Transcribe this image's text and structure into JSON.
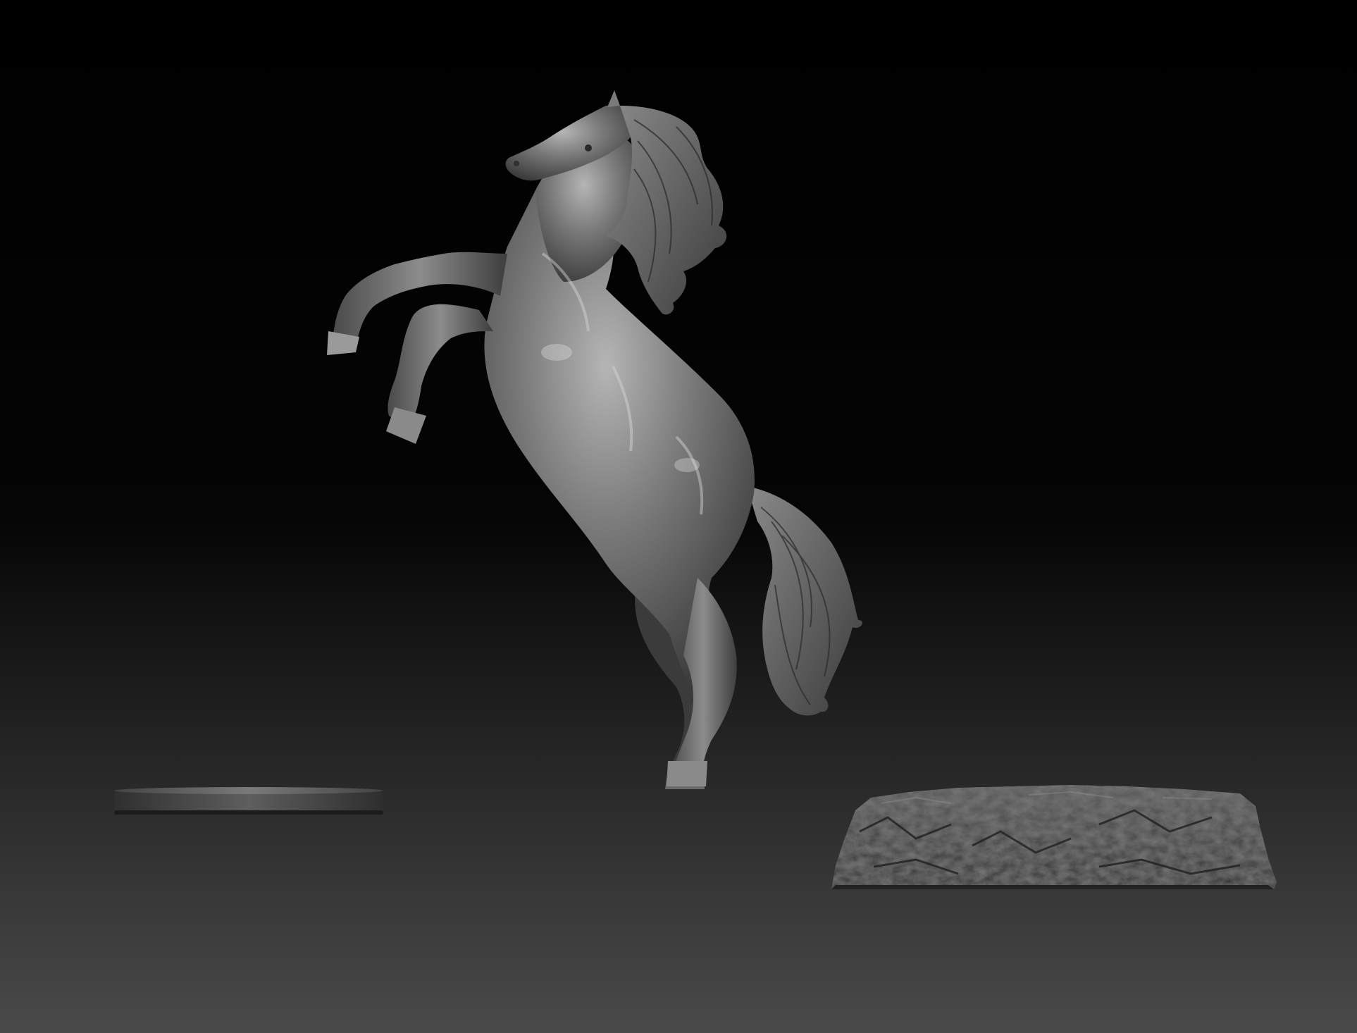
{
  "scene": {
    "subject": "rearing-horse-sculpt",
    "background": {
      "top": "#000000",
      "middle": "#141414",
      "bottom": "#4a4a4a"
    },
    "colors": {
      "horse_base": "#6e6e6e",
      "horse_dark": "#2a2a2a",
      "horse_highlight": "#d6d6d6",
      "disc_base": "#3a3a3a",
      "disc_highlight": "#6a6a6a",
      "rock_base": "#3c3c3c",
      "rock_dark": "#1e1e1e",
      "rock_highlight": "#777777"
    },
    "objects": [
      {
        "name": "horse-sculpture"
      },
      {
        "name": "flat-disc-base"
      },
      {
        "name": "rock-base"
      }
    ]
  }
}
